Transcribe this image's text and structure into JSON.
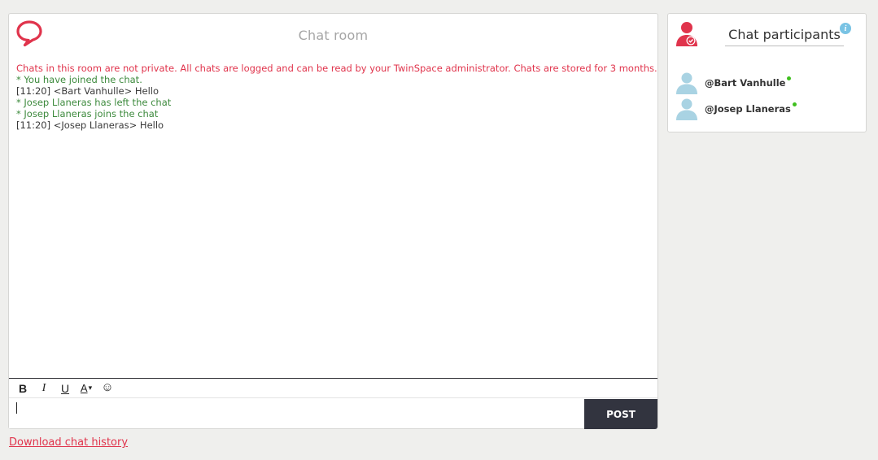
{
  "chat_room": {
    "title": "Chat room",
    "messages": [
      {
        "type": "notice",
        "text": "Chats in this room are not private. All chats are logged and can be read by your TwinSpace administrator. Chats are stored for 3 months."
      },
      {
        "type": "system",
        "text": "* You have joined the chat."
      },
      {
        "type": "chat",
        "text": "[11:20] <Bart Vanhulle> Hello"
      },
      {
        "type": "system",
        "text": "* Josep Llaneras has left the chat"
      },
      {
        "type": "system",
        "text": "* Josep Llaneras joins the chat"
      },
      {
        "type": "chat",
        "text": "[11:20] <Josep Llaneras> Hello"
      }
    ],
    "toolbar": {
      "bold": "B",
      "italic": "I",
      "underline": "U",
      "text_color": "A",
      "text_color_caret": "▾",
      "emoji": "☺"
    },
    "input": {
      "value": "",
      "placeholder": ""
    },
    "post_label": "POST",
    "download_label": "Download chat history"
  },
  "participants": {
    "title": "Chat participants",
    "info_glyph": "i",
    "list": [
      {
        "name": "@Bart Vanhulle",
        "online": true
      },
      {
        "name": "@Josep Llaneras",
        "online": true
      }
    ]
  },
  "colors": {
    "brand": "#e0344c",
    "system_text": "#3d8a3d",
    "post_button": "#32343f",
    "online": "#3fbf1e",
    "info": "#79c3e4",
    "avatar": "#a9d3e3"
  },
  "icons": {
    "logo": "speech-bubble-icon",
    "participants": "user-check-icon",
    "info": "info-icon",
    "avatar": "user-avatar-icon"
  }
}
